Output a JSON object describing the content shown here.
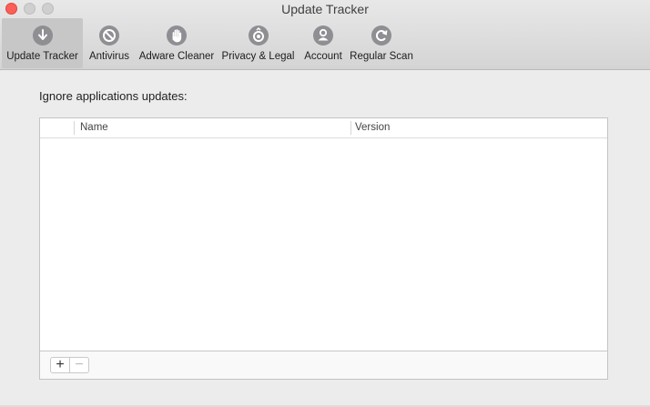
{
  "window": {
    "title": "Update Tracker"
  },
  "toolbar": {
    "items": [
      {
        "label": "Update Tracker",
        "icon": "download-arrow-icon",
        "selected": true
      },
      {
        "label": "Antivirus",
        "icon": "prohibited-icon",
        "selected": false
      },
      {
        "label": "Adware Cleaner",
        "icon": "hand-icon",
        "selected": false
      },
      {
        "label": "Privacy & Legal",
        "icon": "privacy-eye-icon",
        "selected": false
      },
      {
        "label": "Account",
        "icon": "user-icon",
        "selected": false
      },
      {
        "label": "Regular Scan",
        "icon": "refresh-icon",
        "selected": false
      }
    ]
  },
  "main": {
    "section_label": "Ignore applications updates:",
    "table": {
      "columns": [
        "Name",
        "Version"
      ],
      "rows": []
    },
    "footer": {
      "add_label": "+",
      "remove_label": "−"
    }
  },
  "colors": {
    "close_button": "#fc5f57",
    "icon_gray": "#8e8e93"
  }
}
